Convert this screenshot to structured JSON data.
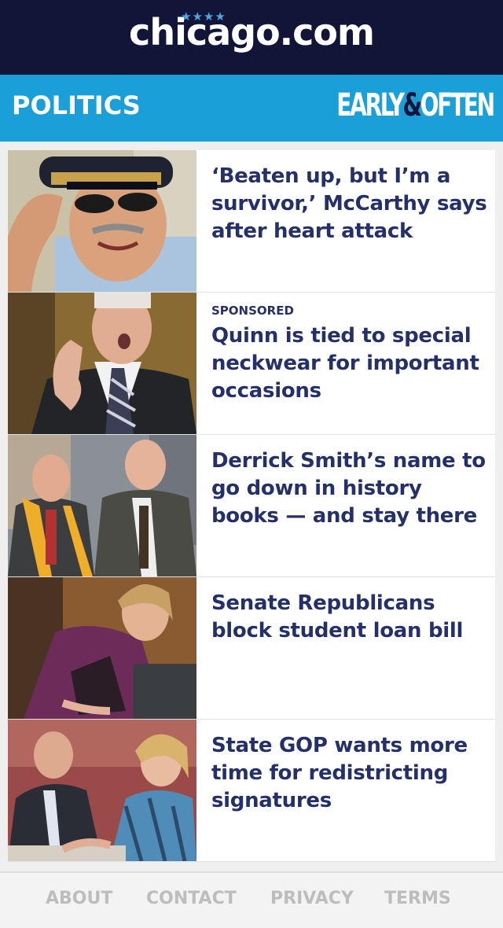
{
  "site": {
    "logo_text": "chicago.com",
    "logo_stars": "★★★★"
  },
  "section": {
    "title": "POLITICS",
    "brand_left": "EARLY",
    "brand_amp": "&",
    "brand_right": "OFTEN"
  },
  "articles": [
    {
      "sponsored": "",
      "headline": "‘Beaten up, but I’m a survivor,’ McCarthy says after heart attack",
      "image": "police-chief-saluting-photo"
    },
    {
      "sponsored": "SPONSORED",
      "headline": "Quinn is tied to special neckwear for important occasions",
      "image": "man-thumbs-up-striped-tie-photo"
    },
    {
      "sponsored": "",
      "headline": "Derrick Smith’s name to go down in history books — and stay there",
      "image": "two-men-walking-city-photo"
    },
    {
      "sponsored": "",
      "headline": "Senate Republicans block student loan bill",
      "image": "woman-at-hearing-photo"
    },
    {
      "sponsored": "",
      "headline": "State GOP wants more time for redistricting signatures",
      "image": "man-and-woman-at-table-photo"
    }
  ],
  "footer": {
    "links": [
      "ABOUT",
      "CONTACT",
      "PRIVACY",
      "TERMS"
    ]
  },
  "colors": {
    "topbar": "#131538",
    "section_bar": "#1b9fd8",
    "headline": "#25306b",
    "footer_link": "#bdbdbd"
  }
}
